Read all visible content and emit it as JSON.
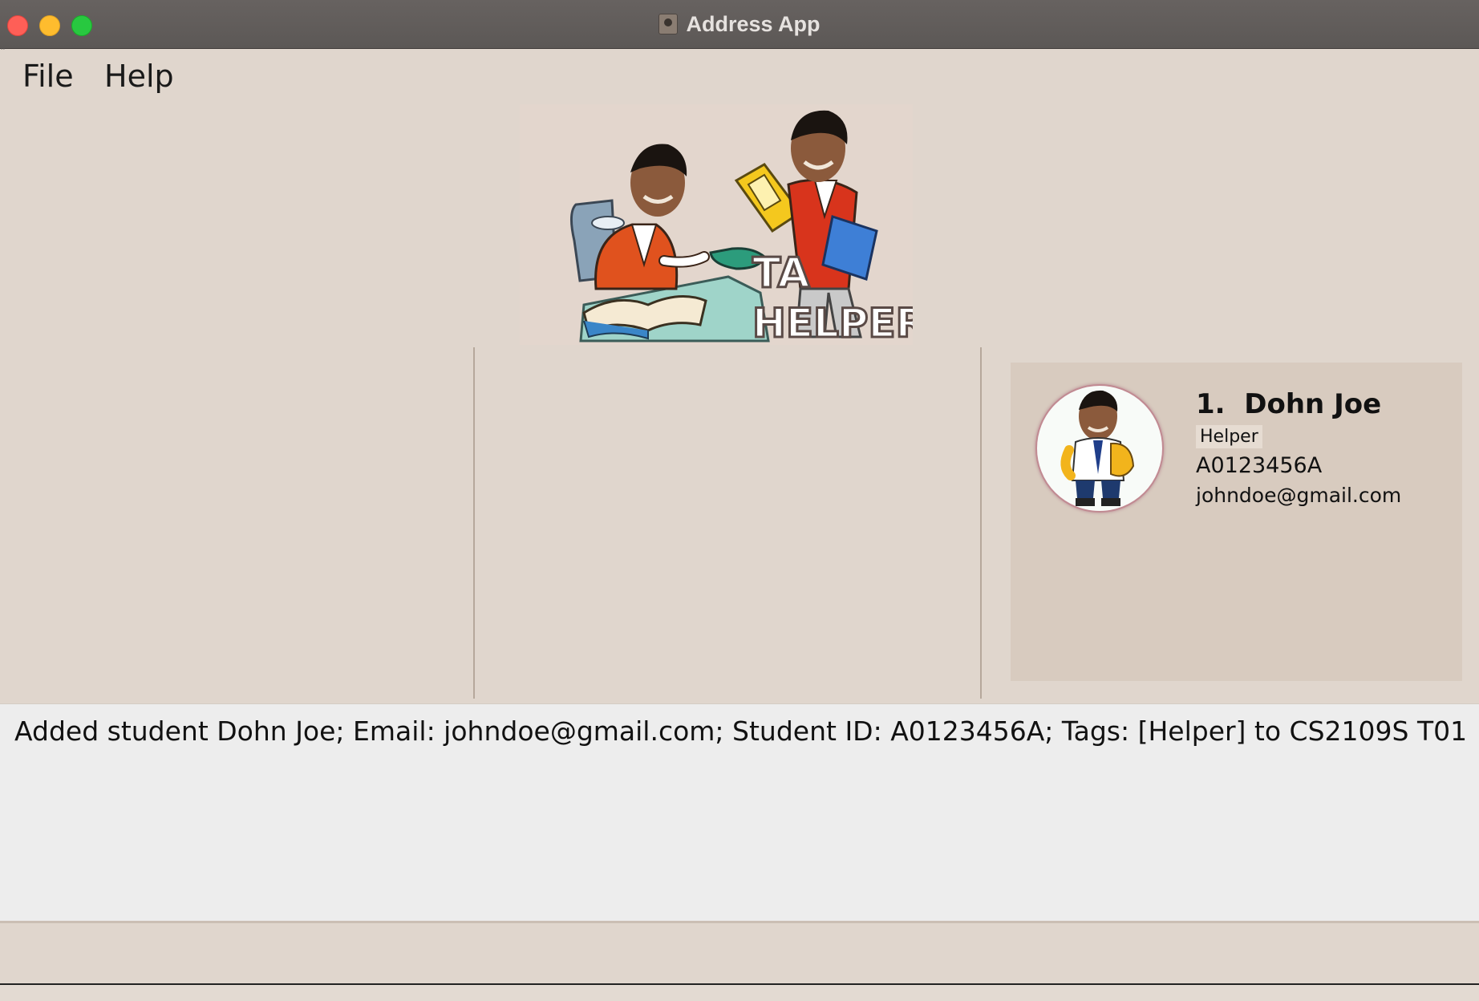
{
  "window": {
    "title": "Address App"
  },
  "menu": {
    "items": [
      {
        "label": "File"
      },
      {
        "label": "Help"
      }
    ]
  },
  "logo": {
    "text_line1": "TA",
    "text_line2": "HELPER"
  },
  "person_card": {
    "name": "1.  Dohn Joe",
    "tag": "Helper",
    "student_id": "A0123456A",
    "email": "johndoe@gmail.com"
  },
  "result_display": {
    "message": "Added student Dohn Joe; Email: johndoe@gmail.com; Student ID: A0123456A; Tags: [Helper] to CS2109S T01"
  },
  "command_box": {
    "value": ""
  },
  "colors": {
    "background": "#e0d6cd",
    "card": "#d8cbbf",
    "result_bg": "#ededed",
    "titlebar": "#5e5a58"
  }
}
